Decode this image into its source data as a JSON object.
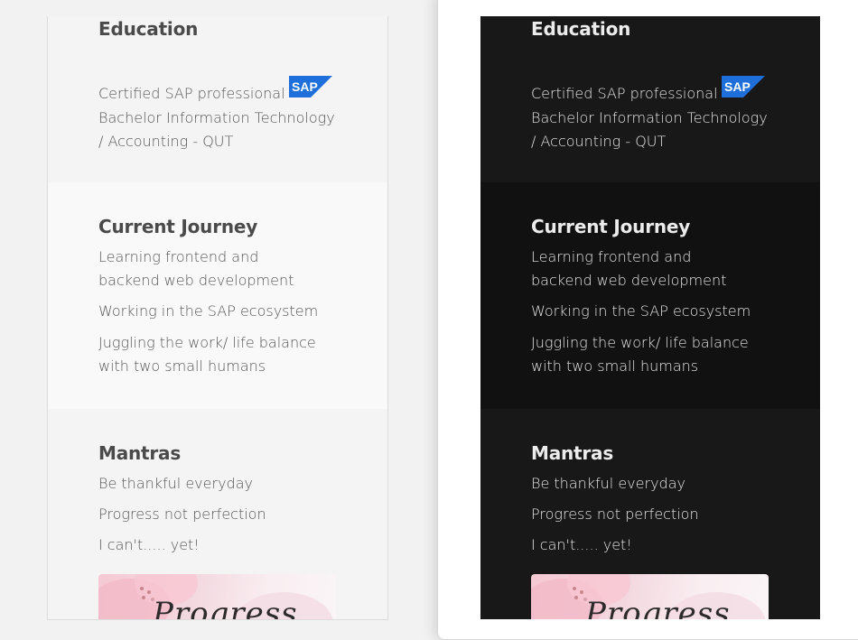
{
  "education": {
    "heading": "Education",
    "certification": "Certified SAP professional",
    "badge_text": "SAP",
    "degree": "Bachelor Information Technology / Accounting - QUT"
  },
  "journey": {
    "heading": "Current Journey",
    "items": [
      "Learning frontend and backend web development",
      "Working in the SAP ecosystem",
      "Juggling the work/ life balance with two small humans"
    ]
  },
  "mantras": {
    "heading": "Mantras",
    "items": [
      "Be thankful everyday",
      "Progress not perfection",
      "I can't..... yet!"
    ],
    "image_caption": "Progress"
  },
  "colors": {
    "sap_blue": "#1e6fd9",
    "light_background": "#f4f4f4",
    "dark_background": "#181818"
  }
}
